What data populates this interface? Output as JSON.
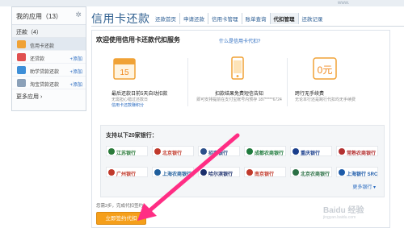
{
  "watermark_top": "www.",
  "sidebar": {
    "header": "我的应用（13）",
    "sub_header": "还款（4）",
    "items": [
      {
        "label": "信用卡还款",
        "add": "",
        "color": "#f0a236"
      },
      {
        "label": "还贷款",
        "add": "+添加",
        "color": "#e05050"
      },
      {
        "label": "助学贷款还款",
        "add": "+添加",
        "color": "#3d8fd8"
      },
      {
        "label": "淘宝贷款还款",
        "add": "+添加",
        "color": "#8aa0b8"
      }
    ],
    "more": "更多应用 ›"
  },
  "header": {
    "title": "信用卡还款",
    "tabs": [
      {
        "label": "还款首页"
      },
      {
        "label": "申请还款"
      },
      {
        "label": "信用卡管理"
      },
      {
        "label": "账单查询"
      },
      {
        "label": "代扣管理"
      },
      {
        "label": "还款记录"
      }
    ],
    "active_tab": 4
  },
  "main": {
    "welcome": "欢迎使用信用卡还款代扣服务",
    "help_link": "什么是信用卡代扣?",
    "features": [
      {
        "icon_text": "15",
        "title": "最后还款日前5天自动扣款",
        "desc": "无需担心错过还款日",
        "link": "信用卡还款赚积分"
      },
      {
        "title": "扣款结果免费短信告知",
        "desc": "即可安排提前在支付宝账号内预存 187*****6724"
      },
      {
        "icon_text": "0元",
        "title": "跨行无手续费",
        "desc": "无论本行还是跨行代扣均无手续费"
      }
    ],
    "banks_title": "支持以下20家银行：",
    "banks": [
      {
        "name": "江苏银行",
        "color": "#2a7a3a"
      },
      {
        "name": "北京银行",
        "color": "#c0392b"
      },
      {
        "name": "招商银行",
        "color": "#2b4f8a"
      },
      {
        "name": "成都农商银行",
        "color": "#1f7a3d"
      },
      {
        "name": "重庆银行",
        "color": "#1a3e8c"
      },
      {
        "name": "常熟农商银行",
        "color": "#b33030"
      },
      {
        "name": "广州银行",
        "color": "#c0392b"
      },
      {
        "name": "上海农商银行",
        "color": "#1f5e9c"
      },
      {
        "name": "哈尔滨银行",
        "color": "#1a2e6b"
      },
      {
        "name": "南京银行",
        "color": "#c0392b"
      },
      {
        "name": "北京农商银行",
        "color": "#2a6f45"
      },
      {
        "name": "上海银行 SRCB",
        "color": "#1c5aa8"
      }
    ],
    "more_banks": "更多银行 ▾",
    "note_text": "您需2步，完成代扣签约",
    "cta": "立即签约代扣"
  },
  "watermark": {
    "title": "Baidu 经验",
    "sub": "jingyan.baidu.com"
  },
  "colors": {
    "accent": "#2f5f8f",
    "cta": "#f59f1b",
    "arrow": "#ff2d84"
  }
}
